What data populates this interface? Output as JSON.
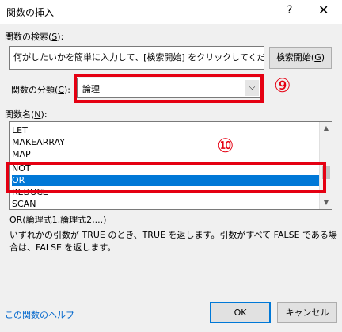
{
  "window": {
    "title": "関数の挿入",
    "help_glyph": "?",
    "close_glyph": "✕"
  },
  "search": {
    "label": "関数の検索(",
    "label_key": "S",
    "label_end": "):",
    "value": "何がしたいかを簡単に入力して、[検索開始] をクリックしてください。",
    "button_text": "検索開始(",
    "button_key": "G",
    "button_end": ")"
  },
  "category": {
    "label": "関数の分類(",
    "label_key": "C",
    "label_end": "):",
    "selected": "論理"
  },
  "function_list": {
    "label": "関数名(",
    "label_key": "N",
    "label_end": "):",
    "items": [
      "LET",
      "MAKEARRAY",
      "MAP",
      "NOT",
      "OR",
      "REDUCE",
      "SCAN"
    ],
    "selected": "OR"
  },
  "annotations": {
    "marker_9": "⑨",
    "marker_10": "⑩",
    "color": "#e50012"
  },
  "description": {
    "syntax": "OR(論理式1,論理式2,...)",
    "line1": "いずれかの引数が TRUE のとき、TRUE を返します。引数がすべて FALSE である場",
    "line2": "合は、FALSE を返します。"
  },
  "footer": {
    "help_link": "この関数のヘルプ",
    "ok": "OK",
    "cancel": "キャンセル"
  }
}
